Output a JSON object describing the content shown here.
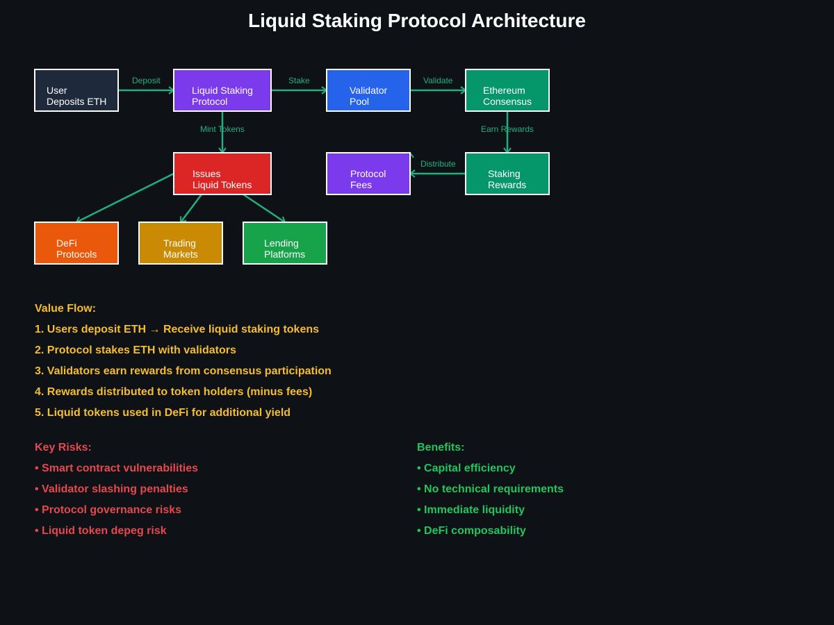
{
  "title": "Liquid Staking Protocol Architecture",
  "diagram": {
    "nodes": {
      "user": {
        "line1": "User",
        "line2": "Deposits ETH",
        "color": "#1e293b"
      },
      "lsp": {
        "line1": "Liquid Staking",
        "line2": "Protocol",
        "color": "#7c3aed"
      },
      "validator": {
        "line1": "Validator",
        "line2": "Pool",
        "color": "#2563eb"
      },
      "consensus": {
        "line1": "Ethereum",
        "line2": "Consensus",
        "color": "#059669"
      },
      "issues": {
        "line1": "Issues",
        "line2": "Liquid Tokens",
        "color": "#dc2626"
      },
      "fees": {
        "line1": "Protocol",
        "line2": "Fees",
        "color": "#7c3aed"
      },
      "rewards": {
        "line1": "Staking",
        "line2": "Rewards",
        "color": "#059669"
      },
      "defi": {
        "line1": "DeFi",
        "line2": "Protocols",
        "color": "#ea580c"
      },
      "trading": {
        "line1": "Trading",
        "line2": "Markets",
        "color": "#ca8a04"
      },
      "lending": {
        "line1": "Lending",
        "line2": "Platforms",
        "color": "#16a34a"
      }
    },
    "edges": {
      "deposit": "Deposit",
      "stake": "Stake",
      "validate": "Validate",
      "mint": "Mint Tokens",
      "earn": "Earn Rewards",
      "distribute": "Distribute"
    },
    "edge_color": "#22b07d"
  },
  "value_flow": {
    "heading": "Value Flow:",
    "items": [
      "1. Users deposit ETH → Receive liquid staking tokens",
      "2. Protocol stakes ETH with validators",
      "3. Validators earn rewards from consensus participation",
      "4. Rewards distributed to token holders (minus fees)",
      "5. Liquid tokens used in DeFi for additional yield"
    ],
    "color": "#f5bd2e"
  },
  "risks": {
    "heading": "Key Risks:",
    "items": [
      "• Smart contract vulnerabilities",
      "• Validator slashing penalties",
      "• Protocol governance risks",
      "• Liquid token depeg risk"
    ],
    "color": "#e5484d"
  },
  "benefits": {
    "heading": "Benefits:",
    "items": [
      "• Capital efficiency",
      "• No technical requirements",
      "• Immediate liquidity",
      "• DeFi composability"
    ],
    "color": "#22c55e"
  }
}
